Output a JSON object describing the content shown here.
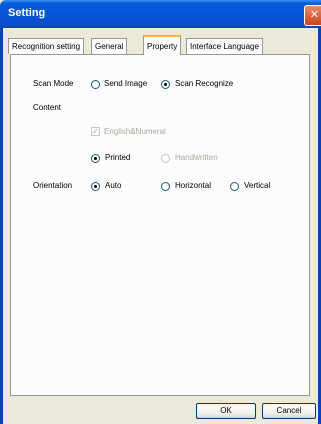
{
  "window": {
    "title": "Setting",
    "close_glyph": "✕"
  },
  "tabs": [
    {
      "label": "Recognition setting",
      "active": false
    },
    {
      "label": "General",
      "active": false
    },
    {
      "label": "Property",
      "active": true
    },
    {
      "label": "Interface Language",
      "active": false
    }
  ],
  "property": {
    "scan_mode": {
      "label": "Scan Mode",
      "options": [
        {
          "label": "Send Image",
          "selected": false
        },
        {
          "label": "Scan  Recognize",
          "selected": true
        }
      ]
    },
    "content": {
      "label": "Content",
      "checkbox": {
        "label": "English&Numeral",
        "checked": true,
        "enabled": false
      },
      "options": [
        {
          "label": "Printed",
          "selected": true,
          "enabled": true
        },
        {
          "label": "Handwritten",
          "selected": false,
          "enabled": false
        }
      ]
    },
    "orientation": {
      "label": "Orientation",
      "options": [
        {
          "label": "Auto",
          "selected": true
        },
        {
          "label": "Horizontal",
          "selected": false
        },
        {
          "label": "Vertical",
          "selected": false
        }
      ]
    }
  },
  "buttons": {
    "ok": "OK",
    "cancel": "Cancel"
  },
  "colors": {
    "titlebar": "#0655d6",
    "close_button": "#c9451d",
    "dialog_bg": "#ece9d8",
    "panel_bg": "#fcfcfe"
  }
}
